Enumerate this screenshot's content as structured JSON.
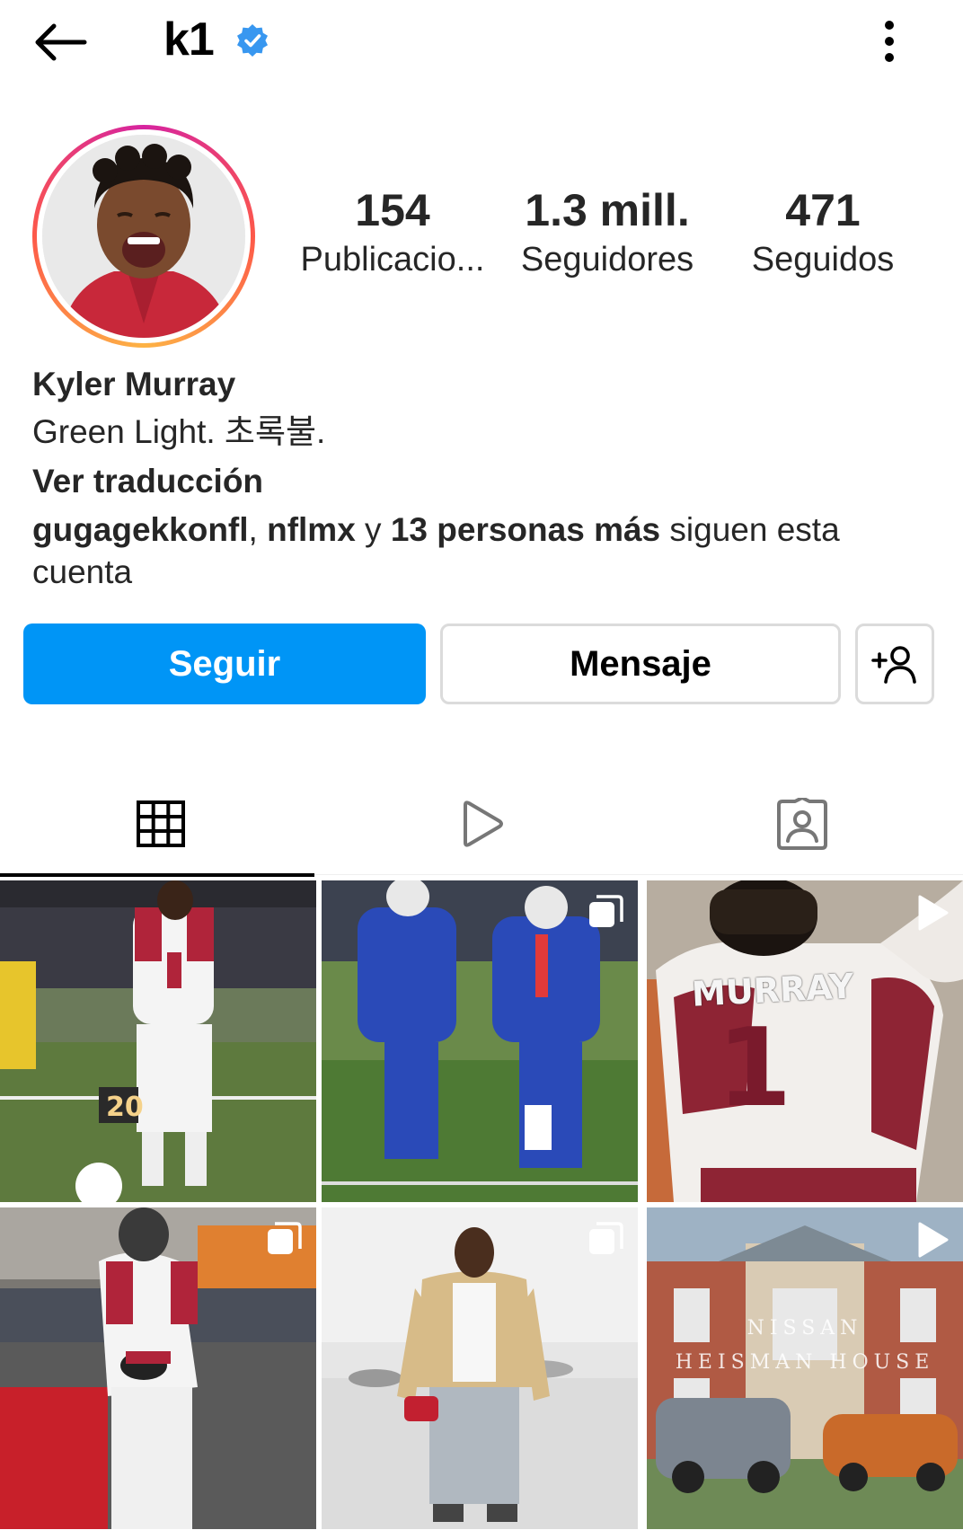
{
  "header": {
    "username": "k1",
    "verified": true,
    "back_icon": "arrow-left-icon",
    "more_icon": "vertical-dots-icon"
  },
  "profile": {
    "stats": [
      {
        "value": "154",
        "label": "Publicacio..."
      },
      {
        "value": "1.3 mill.",
        "label": "Seguidores"
      },
      {
        "value": "471",
        "label": "Seguidos"
      }
    ],
    "full_name": "Kyler Murray",
    "bio": "Green Light. 초록불.",
    "translate_label": "Ver traducción",
    "followed_by": {
      "user1": "gugagekkonfl",
      "sep1": ", ",
      "user2": "nflmx",
      "sep2": " y ",
      "others": "13 personas más",
      "suffix": " siguen esta cuenta"
    }
  },
  "actions": {
    "follow_label": "Seguir",
    "message_label": "Mensaje",
    "suggest_icon": "add-person-icon"
  },
  "tabs": [
    {
      "name": "posts",
      "icon": "grid-icon",
      "active": true
    },
    {
      "name": "reels",
      "icon": "play-icon",
      "active": false
    },
    {
      "name": "tagged",
      "icon": "tagged-person-icon",
      "active": false
    }
  ],
  "posts": [
    {
      "type": "photo",
      "badge": ""
    },
    {
      "type": "carousel",
      "badge": "carousel-icon"
    },
    {
      "type": "reel",
      "badge": "play-icon",
      "jersey_name": "MURRAY",
      "jersey_number": "1"
    },
    {
      "type": "carousel",
      "badge": "carousel-icon"
    },
    {
      "type": "carousel",
      "badge": "carousel-icon"
    },
    {
      "type": "reel",
      "badge": "play-icon",
      "overlay_line1": "NISSAN",
      "overlay_line2": "HEISMAN HOUSE"
    }
  ],
  "colors": {
    "follow_button": "#0095f6",
    "verified_badge": "#3897f0",
    "cardinals_red": "#97233f"
  }
}
